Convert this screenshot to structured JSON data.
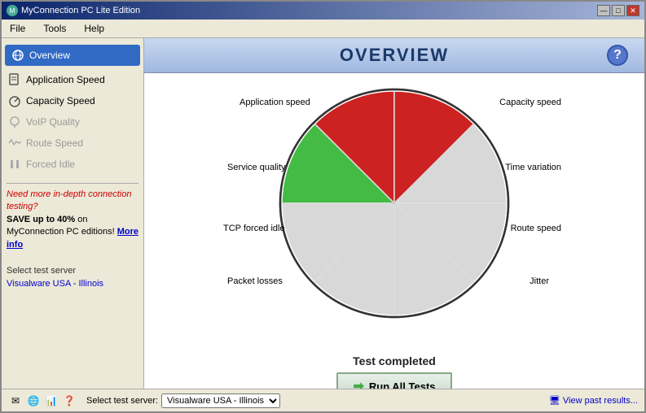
{
  "window": {
    "title": "MyConnection PC Lite Edition",
    "buttons": [
      "—",
      "□",
      "✕"
    ]
  },
  "menu": {
    "items": [
      "File",
      "Tools",
      "Help"
    ]
  },
  "sidebar": {
    "nav_items": [
      {
        "id": "overview",
        "label": "Overview",
        "active": true,
        "icon": "globe"
      },
      {
        "id": "application-speed",
        "label": "Application Speed",
        "active": false,
        "icon": "doc"
      },
      {
        "id": "capacity-speed",
        "label": "Capacity Speed",
        "active": false,
        "icon": "gauge"
      },
      {
        "id": "voip-quality",
        "label": "VoIP Quality",
        "active": false,
        "disabled": true,
        "icon": "headset"
      },
      {
        "id": "route-speed",
        "label": "Route Speed",
        "active": false,
        "disabled": true,
        "icon": "wave"
      },
      {
        "id": "forced-idle",
        "label": "Forced Idle",
        "active": false,
        "disabled": true,
        "icon": "pause"
      }
    ],
    "promo": {
      "line1": "Need more in-depth connection testing?",
      "line2": "SAVE up to 40%",
      "line3": " on MyConnection PC editions! ",
      "link": "More info"
    },
    "server_label": "Select test server",
    "server_value": "Visualware USA - Illinois"
  },
  "header": {
    "title": "OVERVIEW",
    "help_label": "?"
  },
  "chart": {
    "segments": [
      {
        "label": "Application speed",
        "angle_start": 270,
        "angle_end": 360,
        "color": "#cc2222",
        "position": "top-left"
      },
      {
        "label": "Capacity speed",
        "angle_start": 0,
        "angle_end": 90,
        "color": "#cc2222",
        "position": "top-right"
      },
      {
        "label": "Service quality",
        "angle_start": 180,
        "angle_end": 270,
        "color": "#44aa44",
        "position": "left"
      },
      {
        "label": "Time variation",
        "angle_start": 90,
        "angle_end": 180,
        "color": "#cccccc",
        "position": "right"
      },
      {
        "label": "TCP forced idle",
        "angle_start": 180,
        "angle_end": 225,
        "color": "#cccccc",
        "position": "left-low"
      },
      {
        "label": "Route speed",
        "angle_start": 315,
        "angle_end": 360,
        "color": "#cccccc",
        "position": "right-low"
      },
      {
        "label": "Packet losses",
        "angle_start": 225,
        "angle_end": 270,
        "color": "#cccccc",
        "position": "bottom-left"
      },
      {
        "label": "Jitter",
        "angle_start": 270,
        "angle_end": 315,
        "color": "#cccccc",
        "position": "bottom-right"
      }
    ],
    "labels": {
      "application_speed": "Application speed",
      "capacity_speed": "Capacity speed",
      "service_quality": "Service quality",
      "time_variation": "Time variation",
      "tcp_forced_idle": "TCP forced idle",
      "route_speed": "Route speed",
      "packet_losses": "Packet losses",
      "jitter": "Jitter"
    }
  },
  "test": {
    "status": "Test completed",
    "run_button": "Run All Tests"
  },
  "statusbar": {
    "server_label": "Select test server:",
    "server_value": "Visualware USA - Illinois",
    "view_results": "View past results..."
  }
}
